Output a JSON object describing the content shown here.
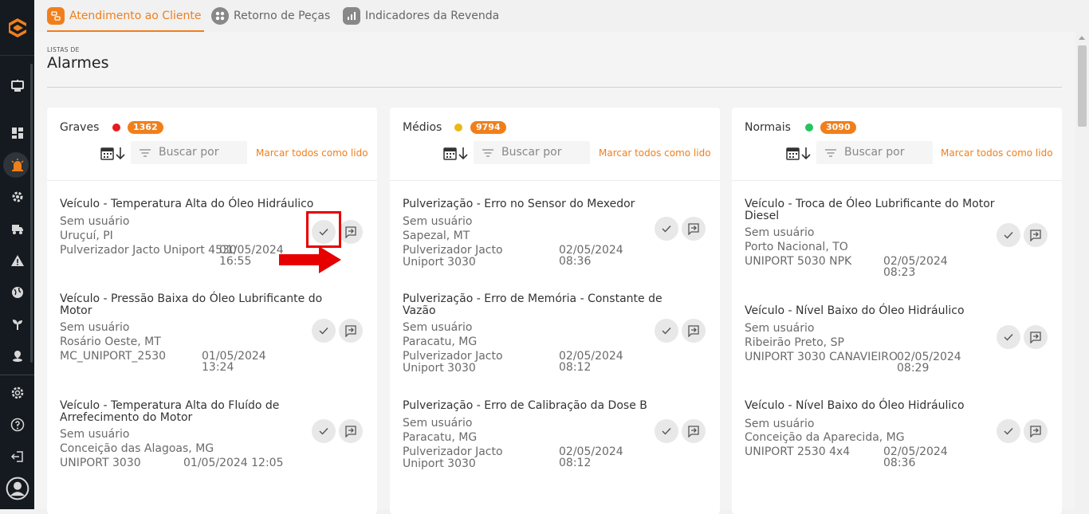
{
  "tabs": [
    {
      "label": "Atendimento ao Cliente",
      "icon": "service-icon",
      "active": true
    },
    {
      "label": "Retorno de Peças",
      "icon": "parts-icon",
      "active": false
    },
    {
      "label": "Indicadores da Revenda",
      "icon": "chart-icon",
      "active": false
    }
  ],
  "page": {
    "subtitle": "LISTAS DE",
    "title": "Alarmes"
  },
  "columns": [
    {
      "name": "Graves",
      "dot_color": "#e8191e",
      "count": "1362",
      "search_placeholder": "Buscar por",
      "mark_all": "Marcar todos como lido",
      "items": [
        {
          "title": "Veículo - Temperatura Alta do Óleo Hidráulico",
          "user": "Sem usuário",
          "location": "Uruçuí, PI",
          "equipment": "Pulverizador Jacto Uniport 4530",
          "date": "01/05/2024",
          "time": "16:55"
        },
        {
          "title": "Veículo - Pressão Baixa do Óleo Lubrificante do Motor",
          "user": "Sem usuário",
          "location": "Rosário Oeste, MT",
          "equipment": "MC_UNIPORT_2530",
          "date": "01/05/2024",
          "time": "13:24"
        },
        {
          "title": "Veículo - Temperatura Alta do Fluído de Arrefecimento do Motor",
          "user": "Sem usuário",
          "location": "Conceição das Alagoas, MG",
          "equipment": "UNIPORT 3030",
          "date": "01/05/2024 12:05",
          "time": ""
        }
      ]
    },
    {
      "name": "Médios",
      "dot_color": "#e8b91a",
      "count": "9794",
      "search_placeholder": "Buscar por",
      "mark_all": "Marcar todos como lido",
      "items": [
        {
          "title": "Pulverização - Erro no Sensor do Mexedor",
          "user": "Sem usuário",
          "location": "Sapezal, MT",
          "equipment": "Pulverizador Jacto Uniport 3030",
          "date": "02/05/2024",
          "time": "08:36"
        },
        {
          "title": "Pulverização - Erro de Memória - Constante de Vazão",
          "user": "Sem usuário",
          "location": "Paracatu, MG",
          "equipment": "Pulverizador Jacto Uniport 3030",
          "date": "02/05/2024",
          "time": "08:12"
        },
        {
          "title": "Pulverização - Erro de Calibração da Dose B",
          "user": "Sem usuário",
          "location": "Paracatu, MG",
          "equipment": "Pulverizador Jacto Uniport 3030",
          "date": "02/05/2024",
          "time": "08:12"
        }
      ]
    },
    {
      "name": "Normais",
      "dot_color": "#22c55e",
      "count": "3090",
      "search_placeholder": "Buscar por",
      "mark_all": "Marcar todos como lido",
      "items": [
        {
          "title": "Veículo - Troca de Óleo Lubrificante do Motor Diesel",
          "user": "Sem usuário",
          "location": "Porto Nacional, TO",
          "equipment": "UNIPORT 5030 NPK",
          "date": "02/05/2024",
          "time": "08:23"
        },
        {
          "title": "Veículo - Nível Baixo do Óleo Hidráulico",
          "user": "Sem usuário",
          "location": "Ribeirão Preto, SP",
          "equipment": "UNIPORT 3030 CANAVIEIRO",
          "date": "02/05/2024",
          "time": "08:29"
        },
        {
          "title": "Veículo - Nível Baixo do Óleo Hidráulico",
          "user": "Sem usuário",
          "location": "Conceição da Aparecida, MG",
          "equipment": "UNIPORT 2530 4x4",
          "date": "02/05/2024",
          "time": "08:36"
        }
      ]
    }
  ],
  "sidebar": {
    "items": [
      "logo-icon",
      "monitor-icon",
      "dashboard-icon",
      "alarm-icon",
      "settings-gear-icon",
      "truck-icon",
      "warning-icon",
      "globe-icon",
      "plant-icon",
      "map-pin-icon",
      "settings-icon",
      "help-icon",
      "logout-icon",
      "user-avatar-icon"
    ]
  },
  "accent_color": "#f07f1b"
}
